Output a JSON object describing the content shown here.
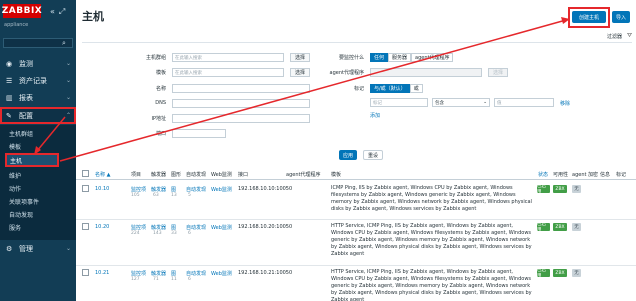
{
  "sidebar": {
    "logo": "ZABBIX",
    "logo_sub": "appliance",
    "icons": [
      "collapse-icon",
      "expand-icon"
    ],
    "menu": [
      {
        "label": "监测",
        "icon": "eye-icon"
      },
      {
        "label": "资产记录",
        "icon": "list-icon"
      },
      {
        "label": "报表",
        "icon": "chart-icon"
      },
      {
        "label": "配置",
        "icon": "wrench-icon"
      }
    ],
    "submenu": [
      "主机群组",
      "模板",
      "主机",
      "维护",
      "动作",
      "关联项事件",
      "自动发现",
      "服务"
    ],
    "bottom_menu": {
      "label": "管理",
      "icon": "gear-icon"
    }
  },
  "header": {
    "title": "主机",
    "create_label": "创建主机",
    "import_label": "导入",
    "filter_label": "过滤器"
  },
  "filter": {
    "host_group_label": "主机群组",
    "template_label": "模板",
    "name_label": "名称",
    "dns_label": "DNS",
    "ip_label": "IP地址",
    "port_label": "端口",
    "placeholder": "在此输入搜索",
    "select_label": "选择",
    "monitored_label": "要监控什么",
    "monitored_options": [
      "任何",
      "服务器",
      "agent代理程序"
    ],
    "proxy_label": "agent代理程序",
    "tags_label": "标记",
    "tag_mode_options": [
      "与/或（默认）",
      "或"
    ],
    "tag_placeholder": "标记",
    "tag_operator": "包含",
    "tag_value_placeholder": "值",
    "remove_label": "移除",
    "add_label": "添加",
    "apply_label": "应用",
    "reset_label": "重设"
  },
  "table": {
    "headers": [
      "名称 ▲",
      "项目",
      "触发器",
      "图形",
      "自动发现",
      "Web监测",
      "接口",
      "agent代理程序",
      "模板",
      "状态",
      "可用性",
      "agent 加密",
      "信息",
      "标记"
    ],
    "rows": [
      {
        "name": "10.10",
        "items": "监控项",
        "items_count": "105",
        "triggers": "触发器",
        "triggers_count": "63",
        "graphs": "图",
        "graphs_count": "13",
        "discovery": "自动发现",
        "discovery_count": "5",
        "web": "Web监测",
        "interface": "192.168.10.10:10050",
        "templates": "ICMP Ping, IIS by Zabbix agent, Windows CPU by Zabbix agent, Windows filesystems by Zabbix agent, Windows generic by Zabbix agent, Windows memory by Zabbix agent, Windows network by Zabbix agent, Windows physical disks by Zabbix agent, Windows services by Zabbix agent",
        "status": "已启用",
        "availability": "ZBX",
        "encryption": "无"
      },
      {
        "name": "10.20",
        "items": "监控项",
        "items_count": "224",
        "triggers": "触发器",
        "triggers_count": "143",
        "graphs": "图",
        "graphs_count": "33",
        "discovery": "自动发现",
        "discovery_count": "6",
        "web": "Web监测",
        "interface": "192.168.10.20:10050",
        "templates": "HTTP Service, ICMP Ping, IIS by Zabbix agent, Windows by Zabbix agent, Windows CPU by Zabbix agent, Windows filesystems by Zabbix agent, Windows generic by Zabbix agent, Windows memory by Zabbix agent, Windows network by Zabbix agent, Windows physical disks by Zabbix agent, Windows services by Zabbix agent",
        "status": "已启用",
        "availability": "ZBX",
        "encryption": "无"
      },
      {
        "name": "10.21",
        "items": "监控项",
        "items_count": "127",
        "triggers": "触发器",
        "triggers_count": "71",
        "graphs": "图",
        "graphs_count": "11",
        "discovery": "自动发现",
        "discovery_count": "6",
        "web": "Web监测",
        "interface": "192.168.10.21:10050",
        "templates": "HTTP Service, ICMP Ping, IIS by Zabbix agent, Windows by Zabbix agent, Windows CPU by Zabbix agent, Windows filesystems by Zabbix agent, Windows generic by Zabbix agent, Windows memory by Zabbix agent, Windows network by Zabbix agent, Windows physical disks by Zabbix agent, Windows services by Zabbix agent",
        "status": "已启用",
        "availability": "ZBX",
        "encryption": "无"
      }
    ]
  },
  "colors": {
    "sidebar": "#123d55",
    "accent": "#0275b8",
    "highlight": "#e5282c",
    "enabled": "#429e47"
  }
}
